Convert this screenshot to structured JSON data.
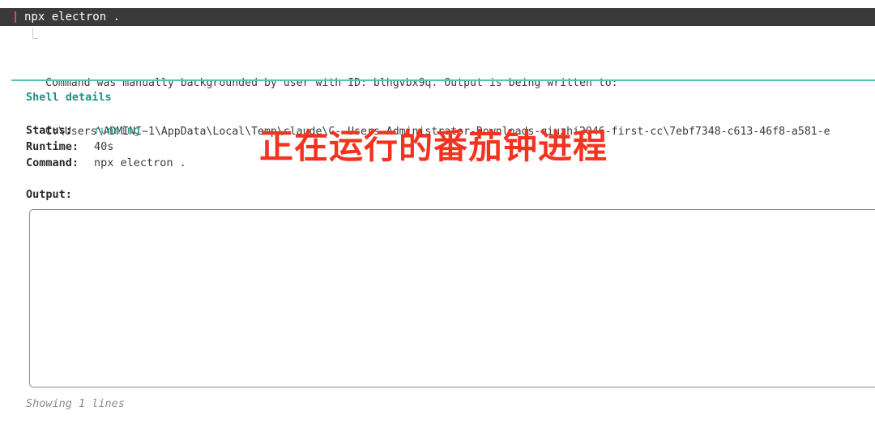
{
  "command_bar": {
    "command": "npx electron .",
    "accent_color": "#e0455a"
  },
  "notice": {
    "tree_glyph": "⎿",
    "line1": "Command was manually backgrounded by user with ID: blhgvbx9q. Output is being written to:",
    "line2": "C:\\Users\\ADMINI~1\\AppData\\Local\\Temp\\claude\\C--Users-Administrator-Downloads-qiuzhi2046-first-cc\\7ebf7348-c613-46f8-a581-e"
  },
  "shell_details": {
    "title": "Shell details",
    "status_label": "Status:",
    "status_value": "running",
    "runtime_label": "Runtime:",
    "runtime_value": "40s",
    "command_label": "Command:",
    "command_value": "npx electron .",
    "output_label": "Output:",
    "footer": "Showing 1 lines"
  },
  "overlay": {
    "caption": "正在运行的番茄钟进程",
    "color": "#f3331f"
  },
  "colors": {
    "divider": "#5bbfb2",
    "title": "#1e8f86",
    "running": "#2a9d8f"
  }
}
